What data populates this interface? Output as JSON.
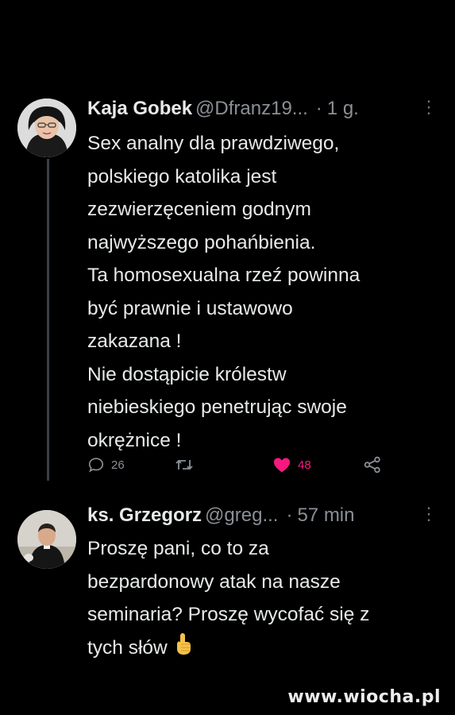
{
  "tweets": [
    {
      "name": "Kaja Gobek",
      "handle": "@Dfranz19...",
      "separator": "·",
      "time": "1 g.",
      "more": "⋮",
      "text": "Sex analny dla prawdziwego,\npolskiego katolika jest\nzezwierzęceniem godnym\nnajwyższego pohańbienia.\nTa homosexualna rzeź powinna\nbyć prawnie i ustawowo\nzakazana !\nNie dostąpicie królestw\nniebieskiego penetrując swoje\nokrężnice !",
      "stats": {
        "replies": "26",
        "likes": "48"
      },
      "colors": {
        "like": "#f91880"
      }
    },
    {
      "name": "ks. Grzegorz",
      "handle": "@greg...",
      "separator": "·",
      "time": "57 min",
      "more": "⋮",
      "text": "Proszę pani, co to za\nbezpardonowy atak na nasze\nseminaria? Proszę wycofać się z\ntych słów",
      "emoji": "pointing-up-hand-icon"
    }
  ],
  "watermark": "www.wiocha.pl"
}
